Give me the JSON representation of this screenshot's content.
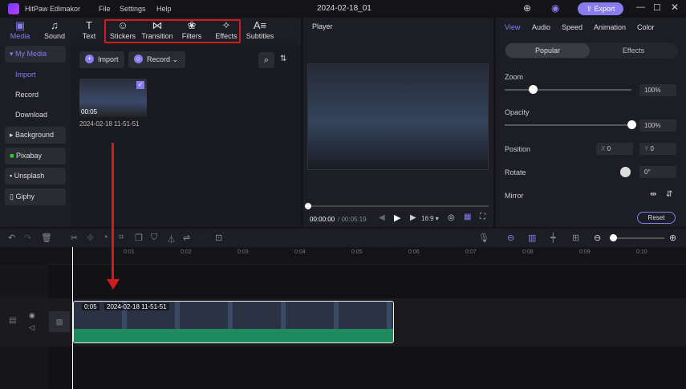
{
  "app": {
    "title": "HitPaw Edimakor",
    "project": "2024-02-18_01",
    "menu": [
      "File",
      "Settings",
      "Help"
    ],
    "export": "Export"
  },
  "toolbar": {
    "items": [
      {
        "label": "Media",
        "icon": "media-icon"
      },
      {
        "label": "Sound",
        "icon": "music-icon"
      },
      {
        "label": "Text",
        "icon": "text-icon"
      },
      {
        "label": "Stickers",
        "icon": "sticker-icon"
      },
      {
        "label": "Transition",
        "icon": "transition-icon"
      },
      {
        "label": "Filters",
        "icon": "filters-icon"
      },
      {
        "label": "Effects",
        "icon": "magic-wand-icon"
      },
      {
        "label": "Subtitles",
        "icon": "subtitles-icon"
      }
    ]
  },
  "sidebar": {
    "my_media": "My Media",
    "sub": [
      "Import",
      "Record",
      "Download"
    ],
    "background": "Background",
    "sources": [
      "Pixabay",
      "Unsplash",
      "Giphy"
    ]
  },
  "media": {
    "import": "Import",
    "record": "Record",
    "clip": {
      "duration": "00:05",
      "name": "2024-02-18 11-51-51"
    }
  },
  "player": {
    "title": "Player",
    "current": "00:00:00",
    "total": "/ 00:05:19",
    "ratio": "16:9"
  },
  "properties": {
    "tabs": [
      "View",
      "Audio",
      "Speed",
      "Animation",
      "Color"
    ],
    "subtabs": [
      "Popular",
      "Effects"
    ],
    "zoom_label": "Zoom",
    "zoom": "100%",
    "zoom_value": 0.2,
    "opacity_label": "Opacity",
    "opacity": "100%",
    "opacity_value": 1.0,
    "position_label": "Position",
    "x_label": "X",
    "x": "0",
    "y_label": "Y",
    "y": "0",
    "rotate_label": "Rotate",
    "rotate": "0°",
    "mirror_label": "Mirror",
    "reset": "Reset"
  },
  "timeline": {
    "ticks": [
      "0:01",
      "0:02",
      "0:03",
      "0:04",
      "0:05",
      "0:06",
      "0:07",
      "0:08",
      "0:09",
      "0:10"
    ],
    "clip_duration": "0:05",
    "clip_name": "2024-02-18 11-51-51"
  },
  "colors": {
    "accent": "#8a7cf0",
    "highlight": "#d01c1c",
    "track": "#1f8a5e"
  }
}
